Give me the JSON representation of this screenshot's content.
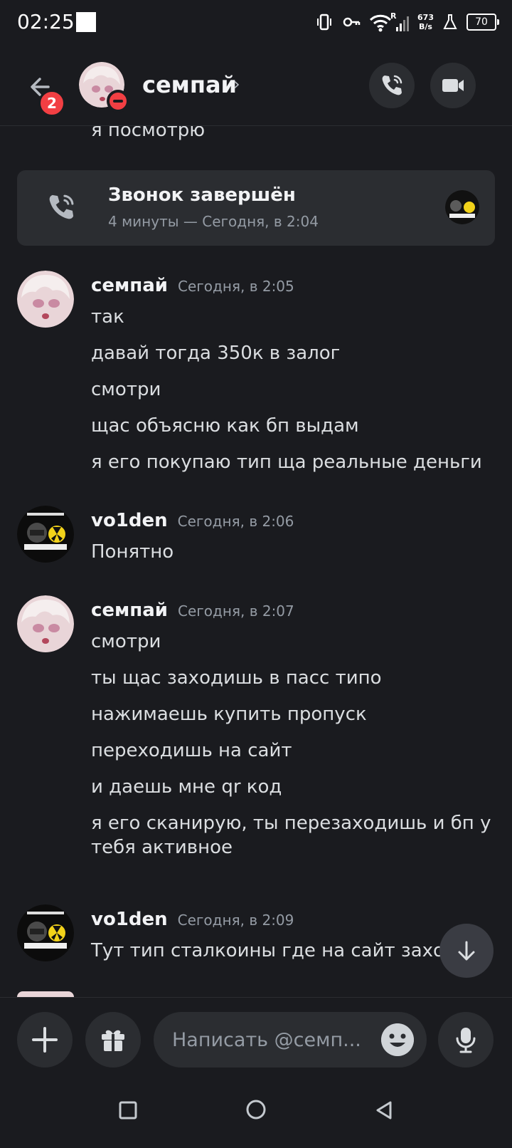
{
  "status_bar": {
    "time": "02:25",
    "network_speed_value": "673",
    "network_speed_unit": "B/s",
    "battery": "70"
  },
  "header": {
    "badge_count": "2",
    "contact_name": "семпай",
    "chevron": "›"
  },
  "partial_message": "я посмотрю",
  "call_card": {
    "title": "Звонок завершён",
    "subtitle": "4 минуты — Сегодня, в 2:04"
  },
  "messages": [
    {
      "author": "семпай",
      "time": "Сегодня, в 2:05",
      "lines": [
        "так",
        "давай тогда 350к в залог",
        "смотри",
        "щас объясню как бп выдам",
        "я его покупаю тип ща реальные деньги"
      ]
    },
    {
      "author": "vo1den",
      "time": "Сегодня, в 2:06",
      "lines": [
        "Понятно"
      ]
    },
    {
      "author": "семпай",
      "time": "Сегодня, в 2:07",
      "lines": [
        "смотри",
        "ты щас заходишь в пасс типо",
        "нажимаешь купить пропуск",
        "переходишь на сайт",
        "и даешь мне qr код",
        "я его сканирую, ты перезаходишь и бп у тебя активное"
      ]
    },
    {
      "author": "vo1den",
      "time": "Сегодня, в 2:09",
      "lines": [
        "Тут тип сталкоины где на сайт захо"
      ]
    }
  ],
  "composer": {
    "placeholder": "Написать @семп..."
  },
  "colors": {
    "background": "#1a1b1f",
    "card": "#2b2d31",
    "badge_red": "#f23f43",
    "muted_text": "#949ba4"
  },
  "icons": [
    "back-arrow-icon",
    "phone-call-icon",
    "video-camera-icon",
    "plus-icon",
    "gift-icon",
    "emoji-icon",
    "microphone-icon",
    "arrow-down-icon"
  ]
}
